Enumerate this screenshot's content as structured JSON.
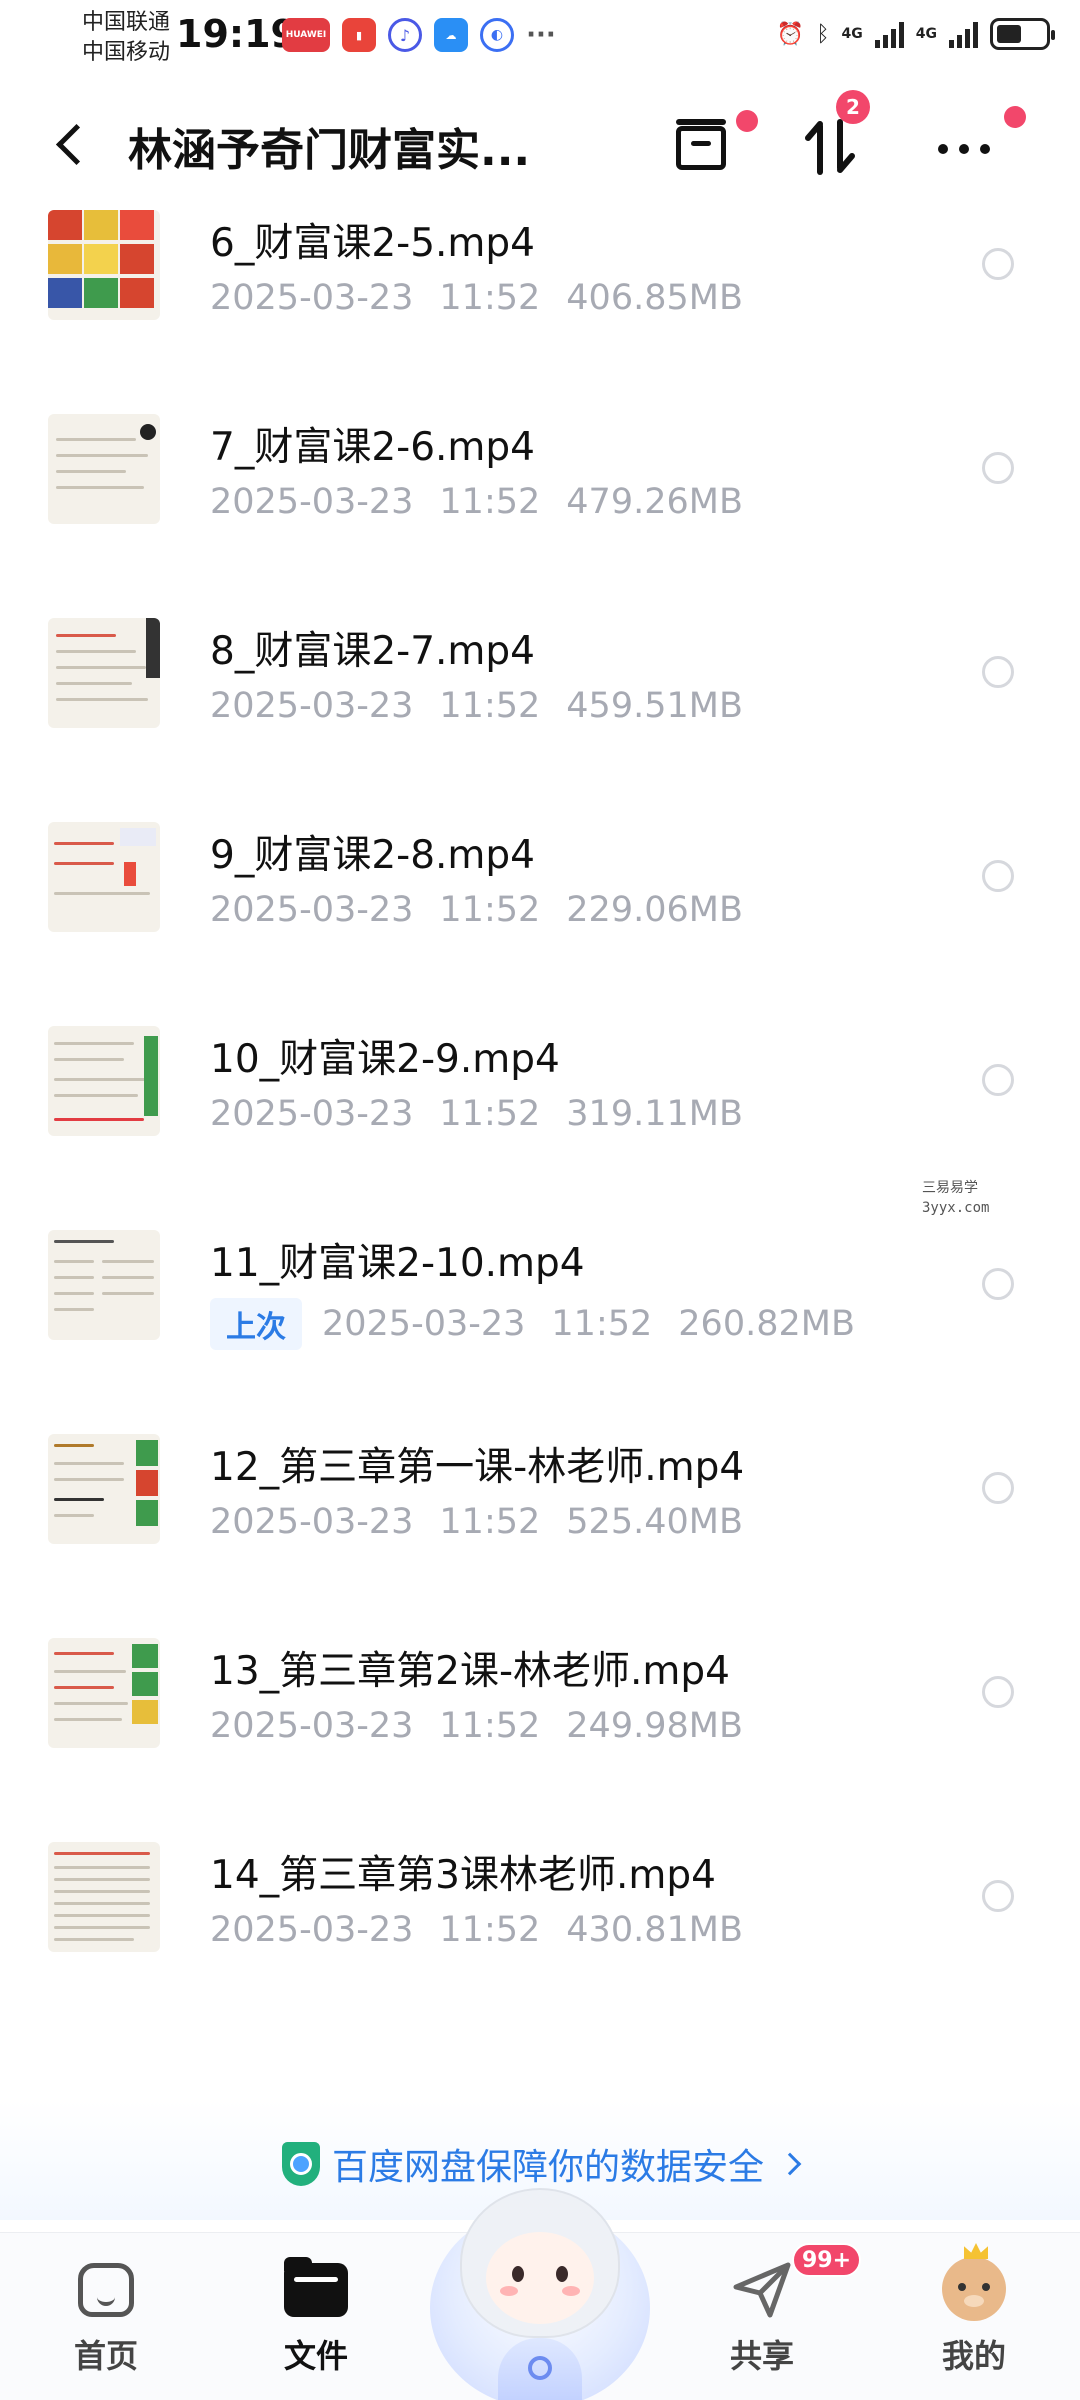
{
  "status_bar": {
    "carrier_1": "中国联通",
    "carrier_2": "中国移动",
    "time": "19:19",
    "notif_huawei": "HUAWEI",
    "notif_more": "···",
    "net_1": "4G",
    "net_2": "4G"
  },
  "header": {
    "title": "林涵予奇门财富实...",
    "transfer_badge": "2"
  },
  "files": [
    {
      "name": "6_财富课2-5.mp4",
      "date": "2025-03-23",
      "time": "11:52",
      "size": "406.85MB",
      "tag": ""
    },
    {
      "name": "7_财富课2-6.mp4",
      "date": "2025-03-23",
      "time": "11:52",
      "size": "479.26MB",
      "tag": ""
    },
    {
      "name": "8_财富课2-7.mp4",
      "date": "2025-03-23",
      "time": "11:52",
      "size": "459.51MB",
      "tag": ""
    },
    {
      "name": "9_财富课2-8.mp4",
      "date": "2025-03-23",
      "time": "11:52",
      "size": "229.06MB",
      "tag": ""
    },
    {
      "name": "10_财富课2-9.mp4",
      "date": "2025-03-23",
      "time": "11:52",
      "size": "319.11MB",
      "tag": ""
    },
    {
      "name": "11_财富课2-10.mp4",
      "date": "2025-03-23",
      "time": "11:52",
      "size": "260.82MB",
      "tag": "上次"
    },
    {
      "name": "12_第三章第一课-林老师.mp4",
      "date": "2025-03-23",
      "time": "11:52",
      "size": "525.40MB",
      "tag": ""
    },
    {
      "name": "13_第三章第2课-林老师.mp4",
      "date": "2025-03-23",
      "time": "11:52",
      "size": "249.98MB",
      "tag": ""
    },
    {
      "name": "14_第三章第3课林老师.mp4",
      "date": "2025-03-23",
      "time": "11:52",
      "size": "430.81MB",
      "tag": ""
    }
  ],
  "watermark": {
    "line_1": "三易易学",
    "line_2": "3yyx.com"
  },
  "security_banner": {
    "text": "百度网盘保障你的数据安全"
  },
  "bottom_nav": {
    "home": "首页",
    "files": "文件",
    "share": "共享",
    "share_badge": "99+",
    "mine": "我的"
  },
  "colors": {
    "accent_blue": "#2b7be5",
    "badge_red": "#f2476b",
    "meta_gray": "#a7aab3"
  }
}
